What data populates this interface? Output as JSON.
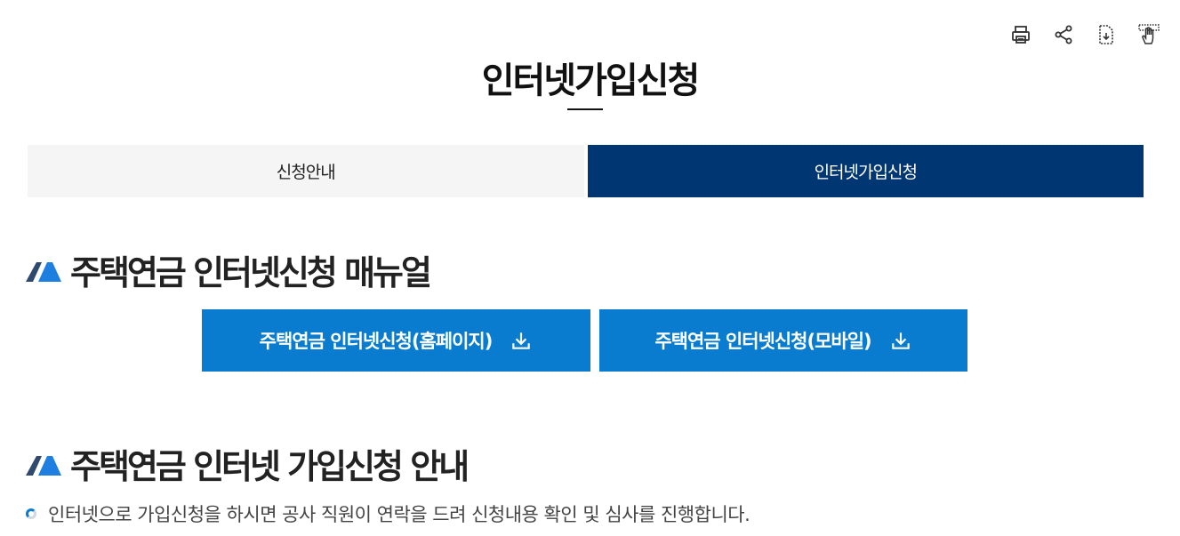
{
  "toolbar": {
    "icons": [
      "print-icon",
      "share-icon",
      "download-doc-icon",
      "hand-cursor-icon"
    ]
  },
  "page": {
    "title": "인터넷가입신청"
  },
  "tabs": [
    {
      "label": "신청안내",
      "active": false
    },
    {
      "label": "인터넷가입신청",
      "active": true
    }
  ],
  "sections": {
    "manual": {
      "heading": "주택연금 인터넷신청 매뉴얼",
      "buttons": [
        {
          "label": "주택연금 인터넷신청(홈페이지)",
          "icon": "download-icon"
        },
        {
          "label": "주택연금 인터넷신청(모바일)",
          "icon": "download-icon"
        }
      ]
    },
    "guide": {
      "heading": "주택연금 인터넷 가입신청 안내",
      "text": "인터넷으로 가입신청을 하시면 공사 직원이 연락을 드려 신청내용 확인 및 심사를 진행합니다."
    }
  },
  "colors": {
    "tab_active": "#003672",
    "tab_inactive": "#f5f5f5",
    "button": "#0a7ccf",
    "heading_mark_blue": "#1e7fe0",
    "heading_mark_dark": "#2f4a6e"
  }
}
